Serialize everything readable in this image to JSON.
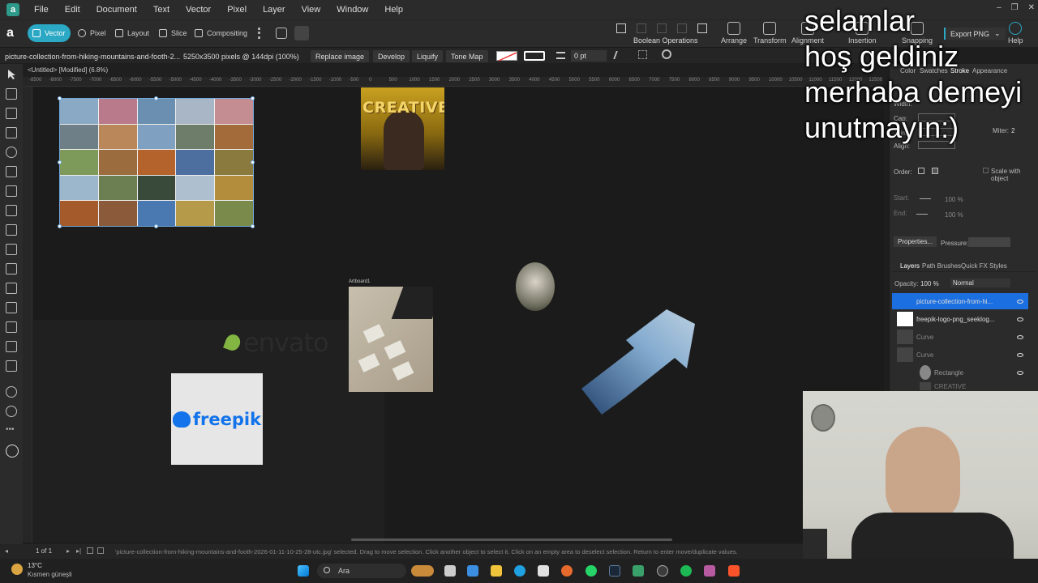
{
  "menubar": {
    "items": [
      "File",
      "Edit",
      "Document",
      "Text",
      "Vector",
      "Pixel",
      "Layer",
      "View",
      "Window",
      "Help"
    ]
  },
  "toolbar": {
    "personas": [
      "Vector",
      "Pixel",
      "Layout",
      "Slice",
      "Compositing"
    ],
    "boolean_label": "Boolean Operations",
    "arrange_label": "Arrange",
    "transform_label": "Transform",
    "alignment_label": "Alignment",
    "insertion_label": "Insertion",
    "snapping_label": "Snapping",
    "export_label": "Export PNG",
    "help_label": "Help"
  },
  "context": {
    "filename": "picture-collection-from-hiking-mountains-and-footh-2...",
    "dims": "5250x3500 pixels @ 144dpi (100%)",
    "replace": "Replace image",
    "develop": "Develop",
    "liquify": "Liquify",
    "tonemap": "Tone Map",
    "stroke_width": "0 pt"
  },
  "tab": {
    "title": "<Untitled> [Modified] (6.8%)"
  },
  "ruler": {
    "labels": [
      "-8500",
      "-8000",
      "-7500",
      "-7000",
      "-6500",
      "-6000",
      "-5500",
      "-5000",
      "-4500",
      "-4000",
      "-3500",
      "-3000",
      "-2500",
      "-2000",
      "-1500",
      "-1000",
      "-500",
      "0",
      "500",
      "1000",
      "1500",
      "2000",
      "2500",
      "3000",
      "3500",
      "4000",
      "4500",
      "5000",
      "5500",
      "6000",
      "6500",
      "7000",
      "7500",
      "8000",
      "8500",
      "9000",
      "9500",
      "10000",
      "10500",
      "11000",
      "11500",
      "12000",
      "12500"
    ]
  },
  "canvas": {
    "creative_text": "CREATIVE",
    "envato_text": "envato",
    "freepik_text": "freepik",
    "artboard_label": "Artboard1"
  },
  "status": {
    "page": "1 of 1",
    "message": "'picture-collection-from-hiking-mountains-and-footh-2026-01-11-10-25-28-utc.jpg' selected. Drag to move selection. Click another object to select it. Click on an empty area to deselect selection. Return to enter move/duplicate values."
  },
  "panel": {
    "top_tabs": [
      "Color",
      "Swatches",
      "Stroke",
      "Appearance"
    ],
    "width_label": "Width:",
    "cap_label": "Cap:",
    "join_label": "Join:",
    "align_label": "Align:",
    "miter_label": "Miter:",
    "miter_value": "2",
    "order_label": "Order:",
    "scale_label": "Scale with object",
    "start_label": "Start:",
    "end_label": "End:",
    "start_pct": "100 %",
    "end_pct": "100 %",
    "properties_label": "Properties...",
    "pressure_label": "Pressure:",
    "layer_tabs": [
      "Layers",
      "Path Brushes",
      "Quick FX",
      "Styles"
    ],
    "opacity_label": "Opacity:",
    "opacity_value": "100 %",
    "blend_mode": "Normal",
    "layers": [
      {
        "name": "picture-collection-from-hi...",
        "selected": true
      },
      {
        "name": "freepik-logo-png_seeklog...",
        "selected": false
      },
      {
        "name": "Curve",
        "selected": false
      },
      {
        "name": "Curve",
        "selected": false
      },
      {
        "name": "Rectangle",
        "selected": false
      },
      {
        "name": "CREATIVE",
        "selected": false
      }
    ]
  },
  "taskbar": {
    "temp": "13°C",
    "weather": "Kısmen güneşli",
    "search": "Ara"
  },
  "overlay": {
    "line1": "selamlar",
    "line2": "hoş geldiniz",
    "line3": "merhaba demeyi",
    "line4": "unutmayın:)"
  }
}
